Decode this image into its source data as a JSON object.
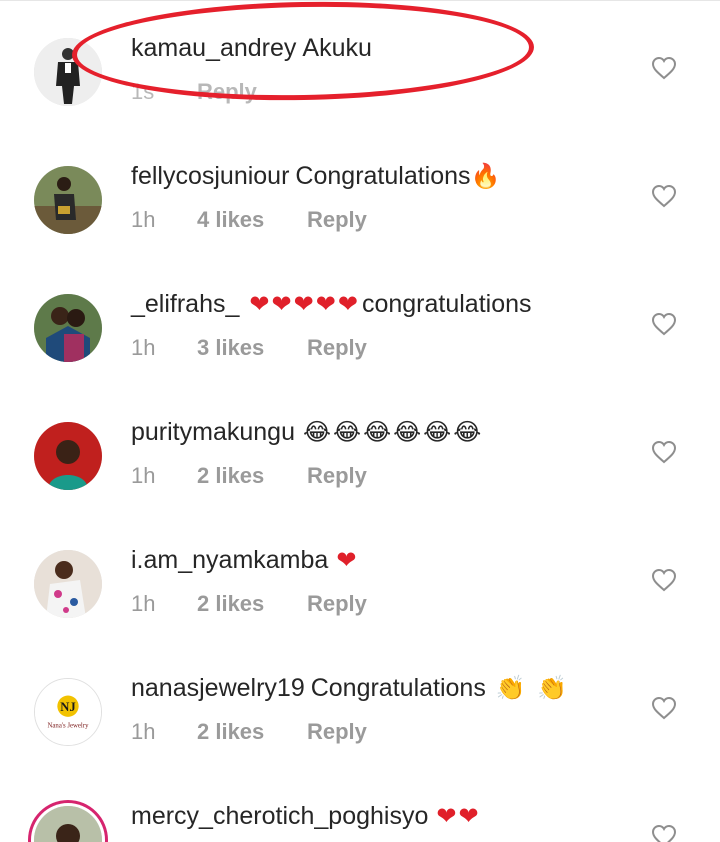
{
  "comments": [
    {
      "username": "kamau_andrey",
      "text": "Akuku",
      "emoji": "",
      "time": "1s",
      "likes": "",
      "reply": "Reply"
    },
    {
      "username": "fellycosjuniour",
      "text": "Congratulations",
      "emoji": "🔥",
      "time": "1h",
      "likes": "4 likes",
      "reply": "Reply"
    },
    {
      "username": "_elifrahs_",
      "text": "congratulations",
      "emoji": "❤❤❤❤❤",
      "time": "1h",
      "likes": "3 likes",
      "reply": "Reply"
    },
    {
      "username": "puritymakungu",
      "text": "",
      "emoji": "😂😂😂😂😂😂",
      "time": "1h",
      "likes": "2 likes",
      "reply": "Reply"
    },
    {
      "username": "i.am_nyamkamba",
      "text": "",
      "emoji": "❤",
      "time": "1h",
      "likes": "2 likes",
      "reply": "Reply"
    },
    {
      "username": "nanasjewelry19",
      "text": "Congratulations",
      "emoji": "👏 👏",
      "time": "1h",
      "likes": "2 likes",
      "reply": "Reply",
      "avatar_logo": "NJ",
      "avatar_logo_caption": "Nana's Jewelry"
    },
    {
      "username": "mercy_cherotich_poghisyo",
      "text": "",
      "emoji": "❤❤",
      "time": "",
      "likes": "",
      "reply": ""
    }
  ],
  "icons": {
    "like": "heart-outline-icon"
  },
  "colors": {
    "annotation": "#e5202c",
    "heart": "#e0202a",
    "story_ring": "#d6246e"
  }
}
